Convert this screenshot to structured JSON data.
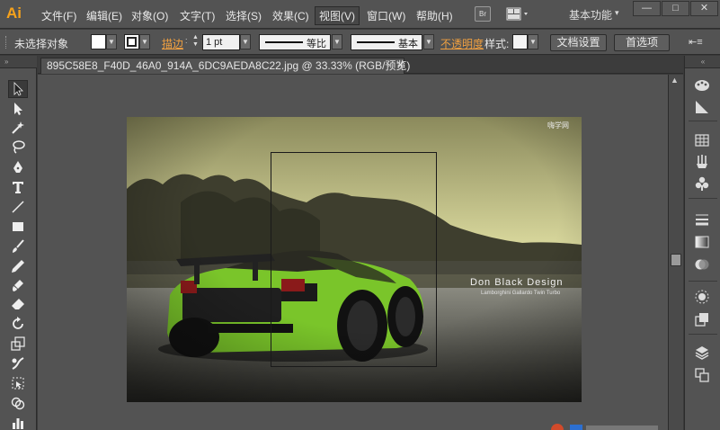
{
  "app": {
    "logo": "Ai"
  },
  "menu": {
    "items": [
      {
        "label": "文件(F)",
        "name": "menu-file"
      },
      {
        "label": "编辑(E)",
        "name": "menu-edit"
      },
      {
        "label": "对象(O)",
        "name": "menu-object"
      },
      {
        "label": "文字(T)",
        "name": "menu-type"
      },
      {
        "label": "选择(S)",
        "name": "menu-select"
      },
      {
        "label": "效果(C)",
        "name": "menu-effect"
      },
      {
        "label": "视图(V)",
        "name": "menu-view"
      },
      {
        "label": "窗口(W)",
        "name": "menu-window"
      },
      {
        "label": "帮助(H)",
        "name": "menu-help"
      }
    ],
    "bridge_label": "Br",
    "workspace": "基本功能",
    "win_min": "—",
    "win_max": "□",
    "win_close": "✕"
  },
  "control": {
    "selection_status": "未选择对象",
    "stroke_label": "描边",
    "stroke_weight": "1 pt",
    "profile_label": "等比",
    "brush_label": "基本",
    "opacity_label": "不透明度",
    "style_label": "样式:",
    "doc_setup": "文档设置",
    "preferences": "首选项"
  },
  "document": {
    "tab_title": "895C58E8_F40D_46A0_914A_6DC9AEDA8C22.jpg @ 33.33% (RGB/预览)",
    "tab_close": "✕"
  },
  "artwork": {
    "brand": "Don Black Design",
    "brand_sub": "Lamborghini Gallardo Twin Turbo",
    "corner_mark": "嗨学网"
  },
  "tools": [
    {
      "name": "selection-tool-icon"
    },
    {
      "name": "direct-selection-tool-icon"
    },
    {
      "name": "magic-wand-tool-icon"
    },
    {
      "name": "lasso-tool-icon"
    },
    {
      "name": "pen-tool-icon"
    },
    {
      "name": "type-tool-icon"
    },
    {
      "name": "line-segment-tool-icon"
    },
    {
      "name": "rectangle-tool-icon"
    },
    {
      "name": "paintbrush-tool-icon"
    },
    {
      "name": "pencil-tool-icon"
    },
    {
      "name": "blob-brush-tool-icon"
    },
    {
      "name": "eraser-tool-icon"
    },
    {
      "name": "rotate-tool-icon"
    },
    {
      "name": "scale-tool-icon"
    },
    {
      "name": "warp-tool-icon"
    },
    {
      "name": "free-transform-tool-icon"
    },
    {
      "name": "shape-builder-tool-icon"
    },
    {
      "name": "graph-tool-icon"
    }
  ],
  "dock": [
    {
      "name": "color-panel-icon"
    },
    {
      "name": "color-guide-panel-icon"
    },
    {
      "name": "swatches-panel-icon"
    },
    {
      "name": "brushes-panel-icon"
    },
    {
      "name": "symbols-panel-icon"
    },
    {
      "name": "stroke-panel-icon"
    },
    {
      "name": "gradient-panel-icon"
    },
    {
      "name": "transparency-panel-icon"
    },
    {
      "name": "appearance-panel-icon"
    },
    {
      "name": "graphic-styles-panel-icon"
    },
    {
      "name": "layers-panel-icon"
    },
    {
      "name": "artboards-panel-icon"
    }
  ],
  "colors": {
    "accent": "#f7a21b",
    "car": "#7ac52a",
    "ui_bg": "#535353"
  }
}
